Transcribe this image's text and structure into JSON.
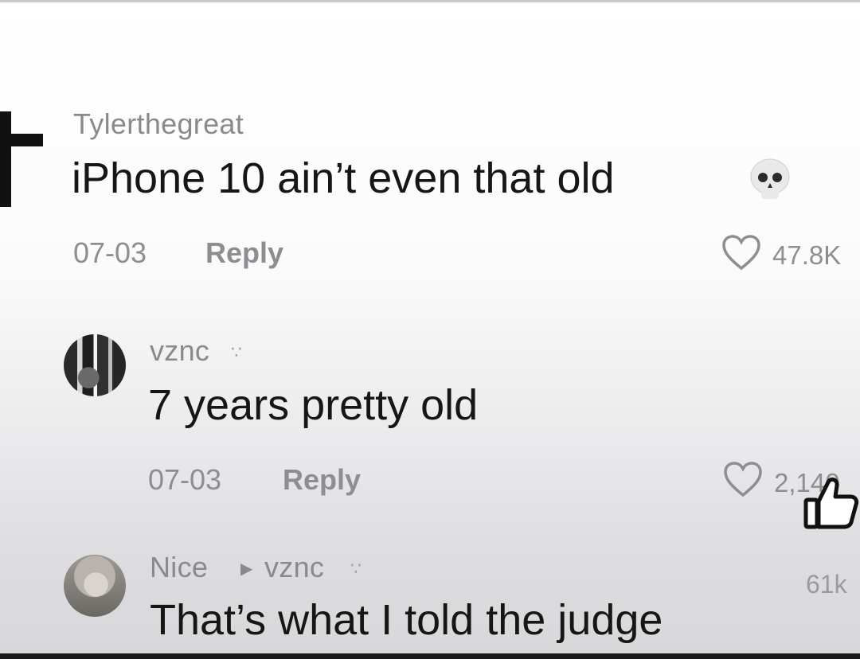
{
  "comments": [
    {
      "username": "Tylerthegreat",
      "text": "iPhone 10 ain’t even that old",
      "emoji": "skull-emoji",
      "date": "07-03",
      "reply_label": "Reply",
      "likes": "47.8K"
    },
    {
      "username": "vznc",
      "text": "7 years pretty old",
      "date": "07-03",
      "reply_label": "Reply",
      "likes": "2,140"
    },
    {
      "username": "Nice",
      "reply_to": "vznc",
      "text": "That’s what I told the judge",
      "likes": "61k"
    }
  ],
  "colors": {
    "text": "#161616",
    "muted": "#8e8e92"
  }
}
